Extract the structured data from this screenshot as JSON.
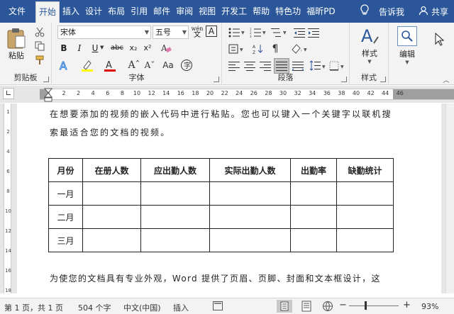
{
  "tabs": [
    "文件",
    "开始",
    "插入",
    "设计",
    "布局",
    "引用",
    "邮件",
    "审阅",
    "视图",
    "开发工",
    "帮助",
    "特色功",
    "福昕PD"
  ],
  "active_tab_index": 1,
  "tell_me": "告诉我",
  "share": "共享",
  "clipboard": {
    "paste_label": "粘贴",
    "group_label": "剪贴板"
  },
  "font": {
    "name": "宋体",
    "size": "五号",
    "group_label": "字体",
    "bold": "B",
    "italic": "I",
    "underline": "U",
    "strike": "abc",
    "subscript": "x₂",
    "superscript": "x²",
    "wen": "wén",
    "wen_char": "文",
    "a_box": "A"
  },
  "paragraph": {
    "group_label": "段落"
  },
  "styles": {
    "label": "样式",
    "group_label": "样式"
  },
  "editing": {
    "label": "编辑"
  },
  "ruler_numbers": [
    "2",
    "2",
    "4",
    "6",
    "8",
    "10",
    "12",
    "14",
    "16",
    "18",
    "20",
    "22",
    "24",
    "26",
    "28",
    "30",
    "32",
    "34",
    "36",
    "38",
    "40",
    "42",
    "44",
    "46"
  ],
  "vruler_numbers": [
    "1",
    "2",
    "4",
    "6",
    "8",
    "10",
    "12",
    "14",
    "16",
    "18"
  ],
  "document": {
    "line1": "在想要添加的视频的嵌入代码中进行粘贴。您也可以键入一个关键字以联机搜",
    "line2": "索最适合您的文档的视频。",
    "table_headers": [
      "月份",
      "在册人数",
      "应出勤人数",
      "实际出勤人数",
      "出勤率",
      "缺勤统计"
    ],
    "table_rows": [
      "一月",
      "二月",
      "三月"
    ],
    "line3": "为使您的文档具有专业外观，Word 提供了页眉、页脚、封面和文本框设计，这"
  },
  "status": {
    "page": "第 1 页，共 1 页",
    "words": "504 个字",
    "lang": "中文(中国)",
    "mode": "插入",
    "zoom": "93%",
    "zoom_minus": "−",
    "zoom_plus": "+"
  },
  "colors": {
    "tab_bar": "#2b579a",
    "ribbon": "#f3f3f3",
    "highlight": "#ffff00",
    "font_color": "#e00000"
  }
}
